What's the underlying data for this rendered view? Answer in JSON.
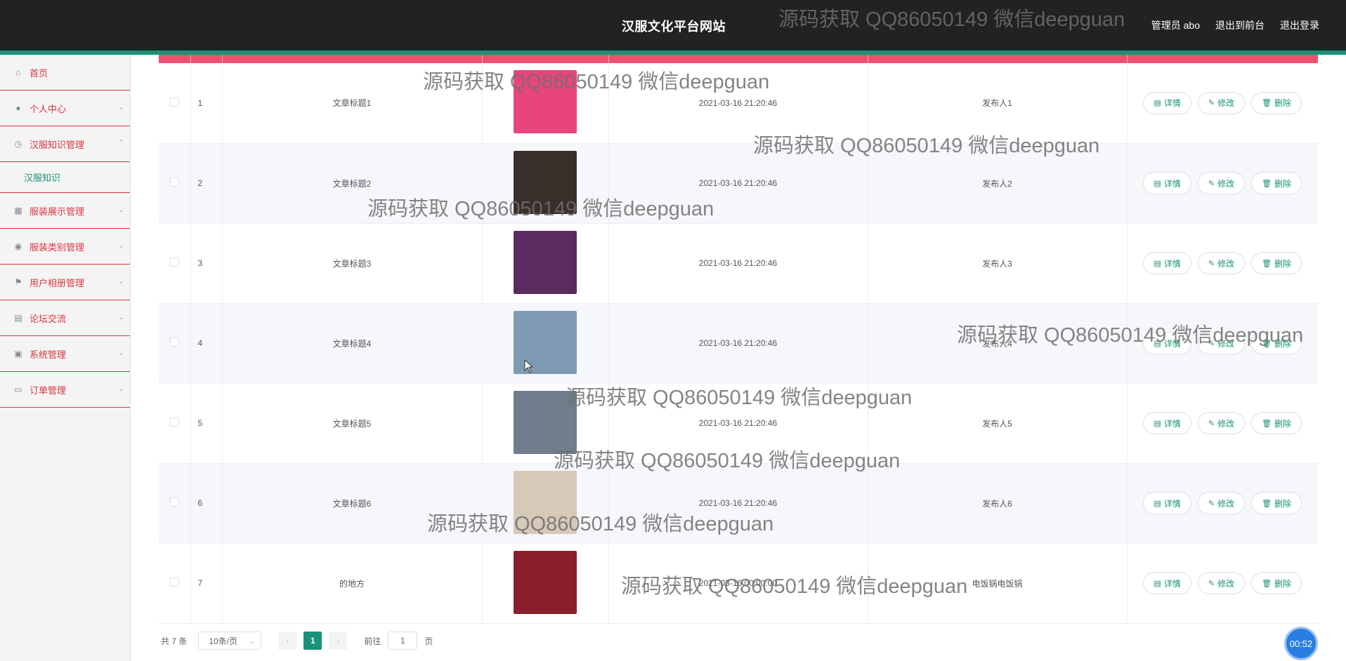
{
  "header": {
    "site_title": "汉服文化平台网站",
    "admin_label": "管理员 abo",
    "to_front": "退出到前台",
    "logout": "退出登录"
  },
  "sidebar": {
    "items": [
      {
        "label": "首页",
        "icon": "home-icon"
      },
      {
        "label": "个人中心",
        "icon": "user-icon"
      },
      {
        "label": "汉服知识管理",
        "icon": "clock-icon",
        "expanded": true
      },
      {
        "label": "服装展示管理",
        "icon": "chart-icon"
      },
      {
        "label": "服装类别管理",
        "icon": "compass-icon"
      },
      {
        "label": "用户相册管理",
        "icon": "flag-icon"
      },
      {
        "label": "论坛交流",
        "icon": "grid-icon"
      },
      {
        "label": "系统管理",
        "icon": "clipboard-icon"
      },
      {
        "label": "订单管理",
        "icon": "trend-icon"
      }
    ],
    "sub_item": "汉服知识"
  },
  "table": {
    "rows": [
      {
        "index": "1",
        "title": "文章标题1",
        "time": "2021-03-16 21:20:46",
        "publisher": "发布人1",
        "img_color": "#e8457a"
      },
      {
        "index": "2",
        "title": "文章标题2",
        "time": "2021-03-16 21:20:46",
        "publisher": "发布人2",
        "img_color": "#3a2e2a"
      },
      {
        "index": "3",
        "title": "文章标题3",
        "time": "2021-03-16 21:20:46",
        "publisher": "发布人3",
        "img_color": "#5b2a5e"
      },
      {
        "index": "4",
        "title": "文章标题4",
        "time": "2021-03-16 21:20:46",
        "publisher": "发布人4",
        "img_color": "#7f9bb3"
      },
      {
        "index": "5",
        "title": "文章标题5",
        "time": "2021-03-16 21:20:46",
        "publisher": "发布人5",
        "img_color": "#6f7d8c"
      },
      {
        "index": "6",
        "title": "文章标题6",
        "time": "2021-03-16 21:20:46",
        "publisher": "发布人6",
        "img_color": "#d7c9b8"
      },
      {
        "index": "7",
        "title": "的地方",
        "time": "2021-03-16 00:00:00",
        "publisher": "电饭锅电饭锅",
        "img_color": "#8a1e2a"
      }
    ],
    "ops": {
      "detail": "详情",
      "edit": "修改",
      "delete": "删除"
    }
  },
  "pager": {
    "total": "共 7 条",
    "page_size": "10条/页",
    "current_page": "1",
    "goto_label": "前往",
    "goto_value": "1",
    "page_unit": "页"
  },
  "watermark": "源码获取 QQ86050149 微信deepguan",
  "timer": "00:52",
  "colors": {
    "accent": "#199278",
    "menu_red": "#d9363e",
    "header_bg": "#222222",
    "table_head": "#f0506e"
  }
}
